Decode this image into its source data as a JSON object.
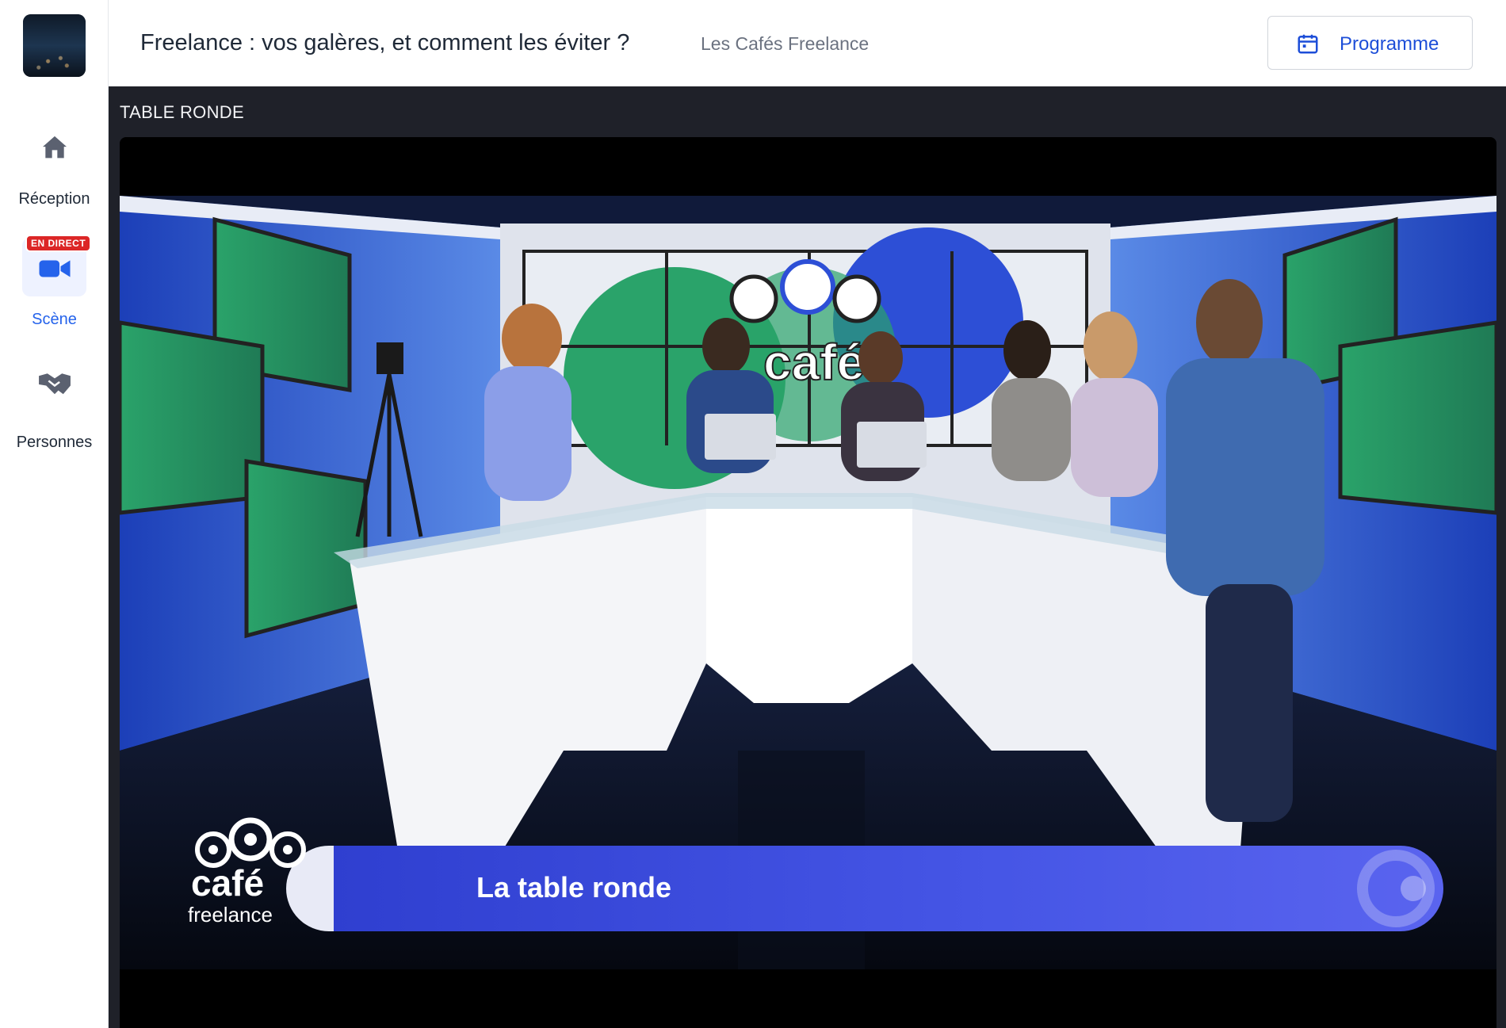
{
  "sidebar": {
    "items": [
      {
        "label": "Réception",
        "icon": "home-icon"
      },
      {
        "label": "Scène",
        "icon": "video-camera-icon",
        "badge": "EN DIRECT"
      },
      {
        "label": "Personnes",
        "icon": "handshake-icon"
      }
    ],
    "logo": "event-logo"
  },
  "header": {
    "title": "Freelance : vos galères, et comment les éviter ?",
    "organizer": "Les Cafés Freelance",
    "program_button": "Programme",
    "program_icon": "calendar-icon"
  },
  "stage": {
    "section_title": "TABLE RONDE",
    "lower_third": "La table ronde",
    "logo_text_1": "café",
    "logo_text_2": "freelance",
    "backdrop_text": "café"
  },
  "colors": {
    "accent": "#1d4ed8",
    "live": "#dc2626",
    "stage_bg": "#1f2129",
    "lower_third": "#3b4ade"
  }
}
